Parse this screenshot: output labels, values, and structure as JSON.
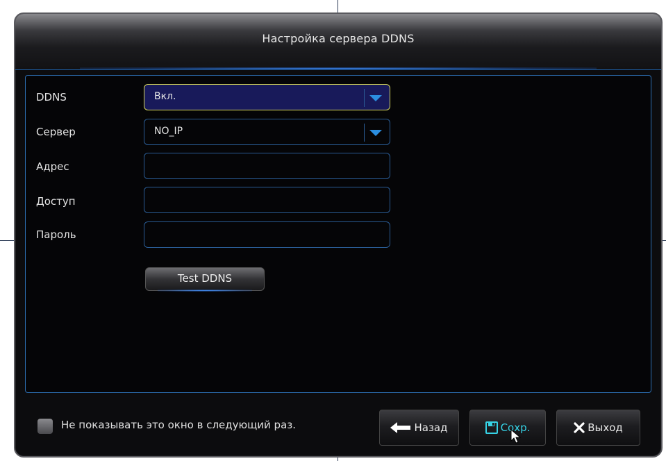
{
  "dialog": {
    "title": "Настройка сервера DDNS"
  },
  "form": {
    "ddns_label": "DDNS",
    "ddns_value": "Вкл.",
    "server_label": "Сервер",
    "server_value": "NO_IP",
    "address_label": "Адрес",
    "address_value": "",
    "access_label": "Доступ",
    "access_value": "",
    "password_label": "Пароль",
    "password_value": "",
    "test_button": "Test DDNS"
  },
  "footer": {
    "checkbox_label": "Не показывать это окно в следующий раз.",
    "checkbox_checked": false,
    "back_button": "Назад",
    "save_button": "Сохр.",
    "exit_button": "Выход"
  },
  "icons": {
    "dropdown": "chevron-down-icon",
    "back": "arrow-left-icon",
    "save": "floppy-disk-icon",
    "exit": "close-icon"
  },
  "colors": {
    "accent_blue": "#2d6fb3",
    "focus_yellow": "#d7d85a",
    "save_cyan": "#36d3e6",
    "selected_bg": "#181a5a"
  }
}
